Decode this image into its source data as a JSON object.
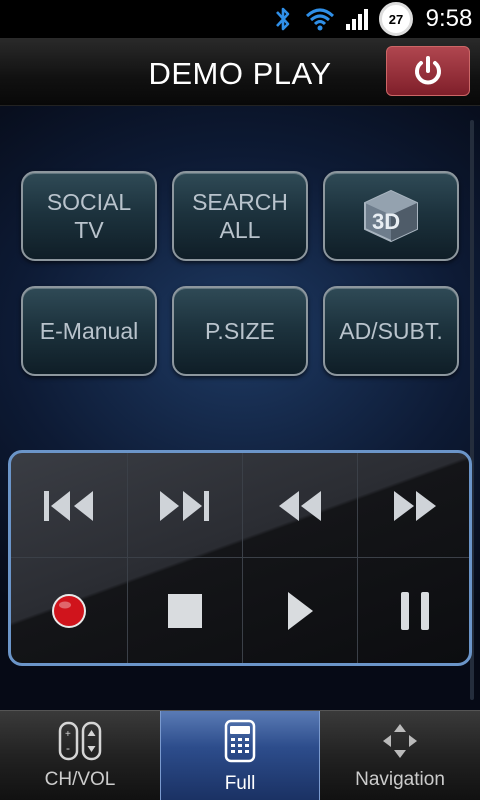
{
  "status_bar": {
    "icons": [
      "bluetooth-icon",
      "wifi-icon",
      "signal-icon",
      "battery-icon"
    ],
    "battery_level": "27",
    "time": "9:58"
  },
  "header": {
    "title": "DEMO PLAY",
    "power_icon": "power-icon",
    "power_color": "#9b3540"
  },
  "function_buttons": [
    {
      "label": "SOCIAL\nTV"
    },
    {
      "label": "SEARCH\nALL"
    },
    {
      "label": "",
      "icon": "3d-icon"
    },
    {
      "label": "E-Manual"
    },
    {
      "label": "P.SIZE"
    },
    {
      "label": "AD/SUBT."
    }
  ],
  "media_controls": [
    "skip-back-icon",
    "skip-forward-icon",
    "rewind-icon",
    "fast-forward-icon",
    "record-icon",
    "stop-icon",
    "play-icon",
    "pause-icon"
  ],
  "bottom_nav": {
    "tabs": [
      {
        "label": "CH/VOL",
        "icon": "ch-vol-icon"
      },
      {
        "label": "Full",
        "icon": "remote-icon",
        "active": true
      },
      {
        "label": "Navigation",
        "icon": "navigation-icon"
      }
    ]
  },
  "colors": {
    "accent_border": "#6b95c9",
    "record_red": "#d0141c",
    "active_tab": "#2d4d8c"
  }
}
